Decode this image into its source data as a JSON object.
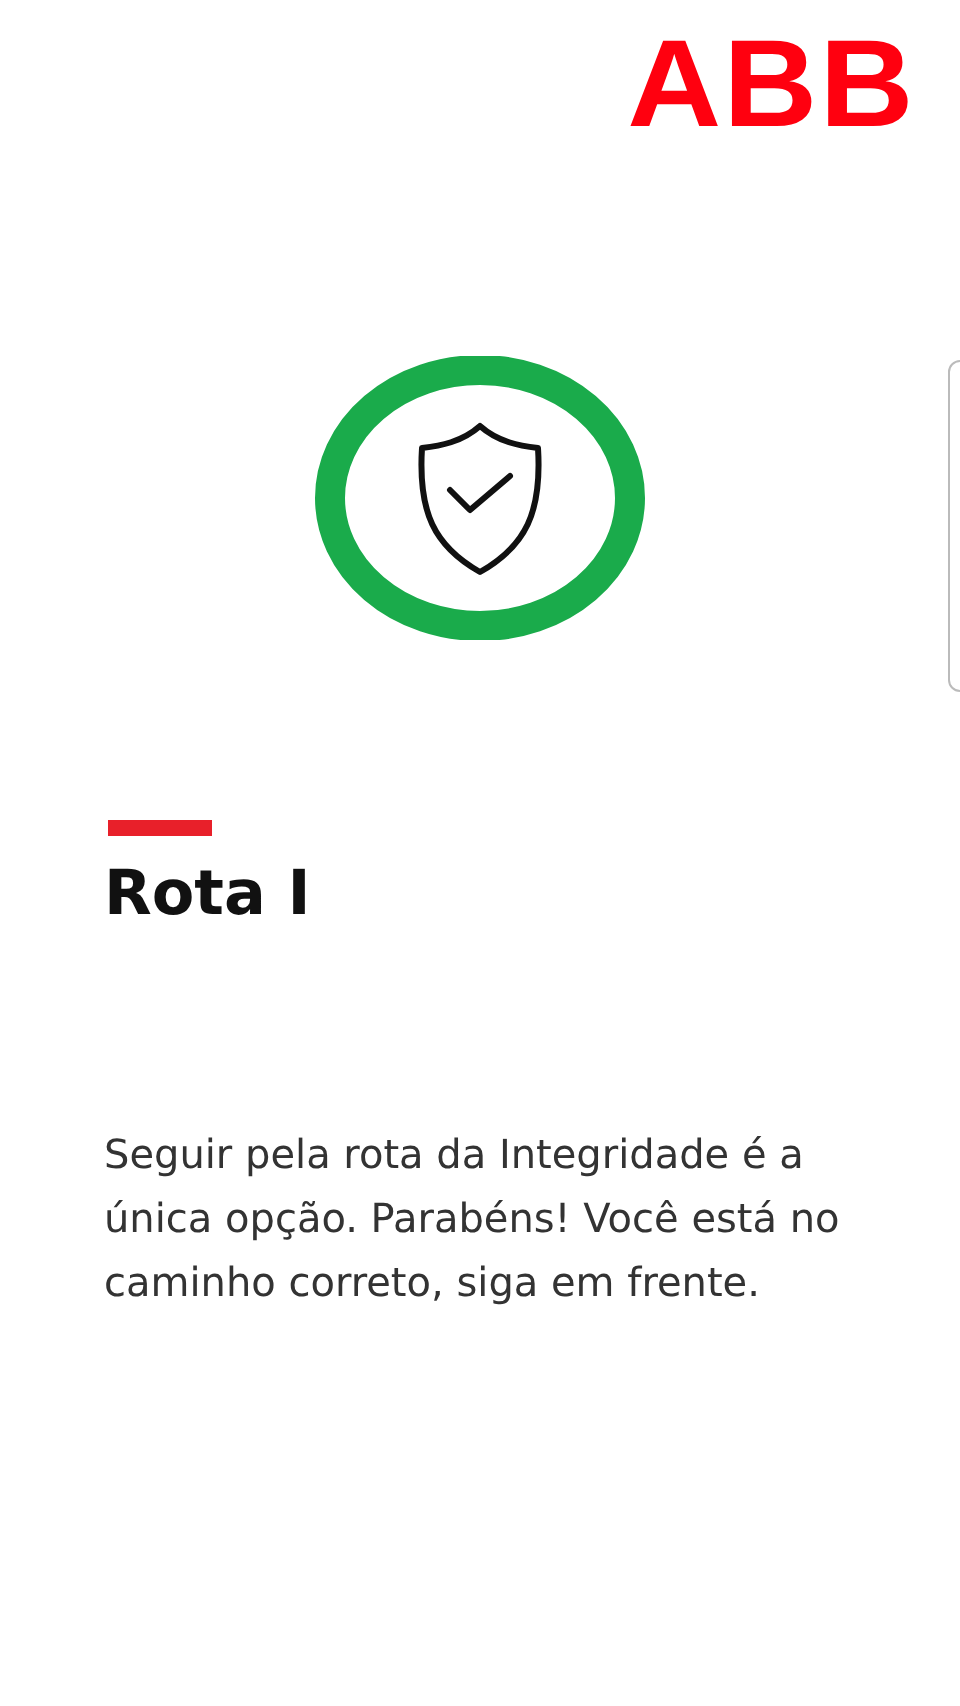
{
  "logo": {
    "text": "ABB"
  },
  "title": "Rota I",
  "message": "Seguir pela rota da Integridade é a única opção. Parabéns! Você está no caminho correto, siga em frente."
}
